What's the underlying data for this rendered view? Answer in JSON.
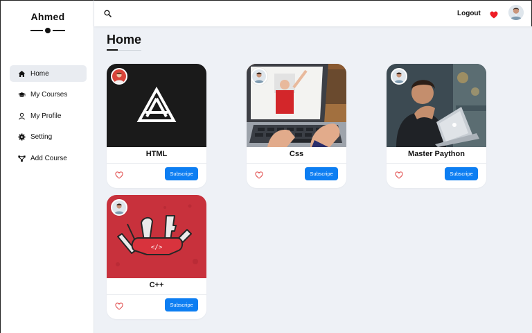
{
  "sidebar": {
    "brand": "Ahmed",
    "items": [
      {
        "label": "Home",
        "icon": "home-icon",
        "active": true
      },
      {
        "label": "My Courses",
        "icon": "graduation-cap-icon",
        "active": false
      },
      {
        "label": "My Profile",
        "icon": "user-icon",
        "active": false
      },
      {
        "label": "Setting",
        "icon": "gear-icon",
        "active": false
      },
      {
        "label": "Add Course",
        "icon": "share-nodes-icon",
        "active": false
      }
    ]
  },
  "topbar": {
    "search_icon": "search-icon",
    "logout_label": "Logout",
    "heart_icon": "heart-icon",
    "heart_color": "#ee1c25"
  },
  "main": {
    "title": "Home",
    "accent_color": "#0d7ef2",
    "courses": [
      {
        "title": "HTML",
        "subscribe_label": "Subscripe",
        "image": "logo-triangle-image"
      },
      {
        "title": "Css",
        "subscribe_label": "Subscripe",
        "image": "laptop-typing-photo"
      },
      {
        "title": "Master Paython",
        "subscribe_label": "Subscripe",
        "image": "man-laptop-photo"
      },
      {
        "title": "C++",
        "subscribe_label": "Subscripe",
        "image": "swiss-knife-code-illustration"
      }
    ]
  }
}
